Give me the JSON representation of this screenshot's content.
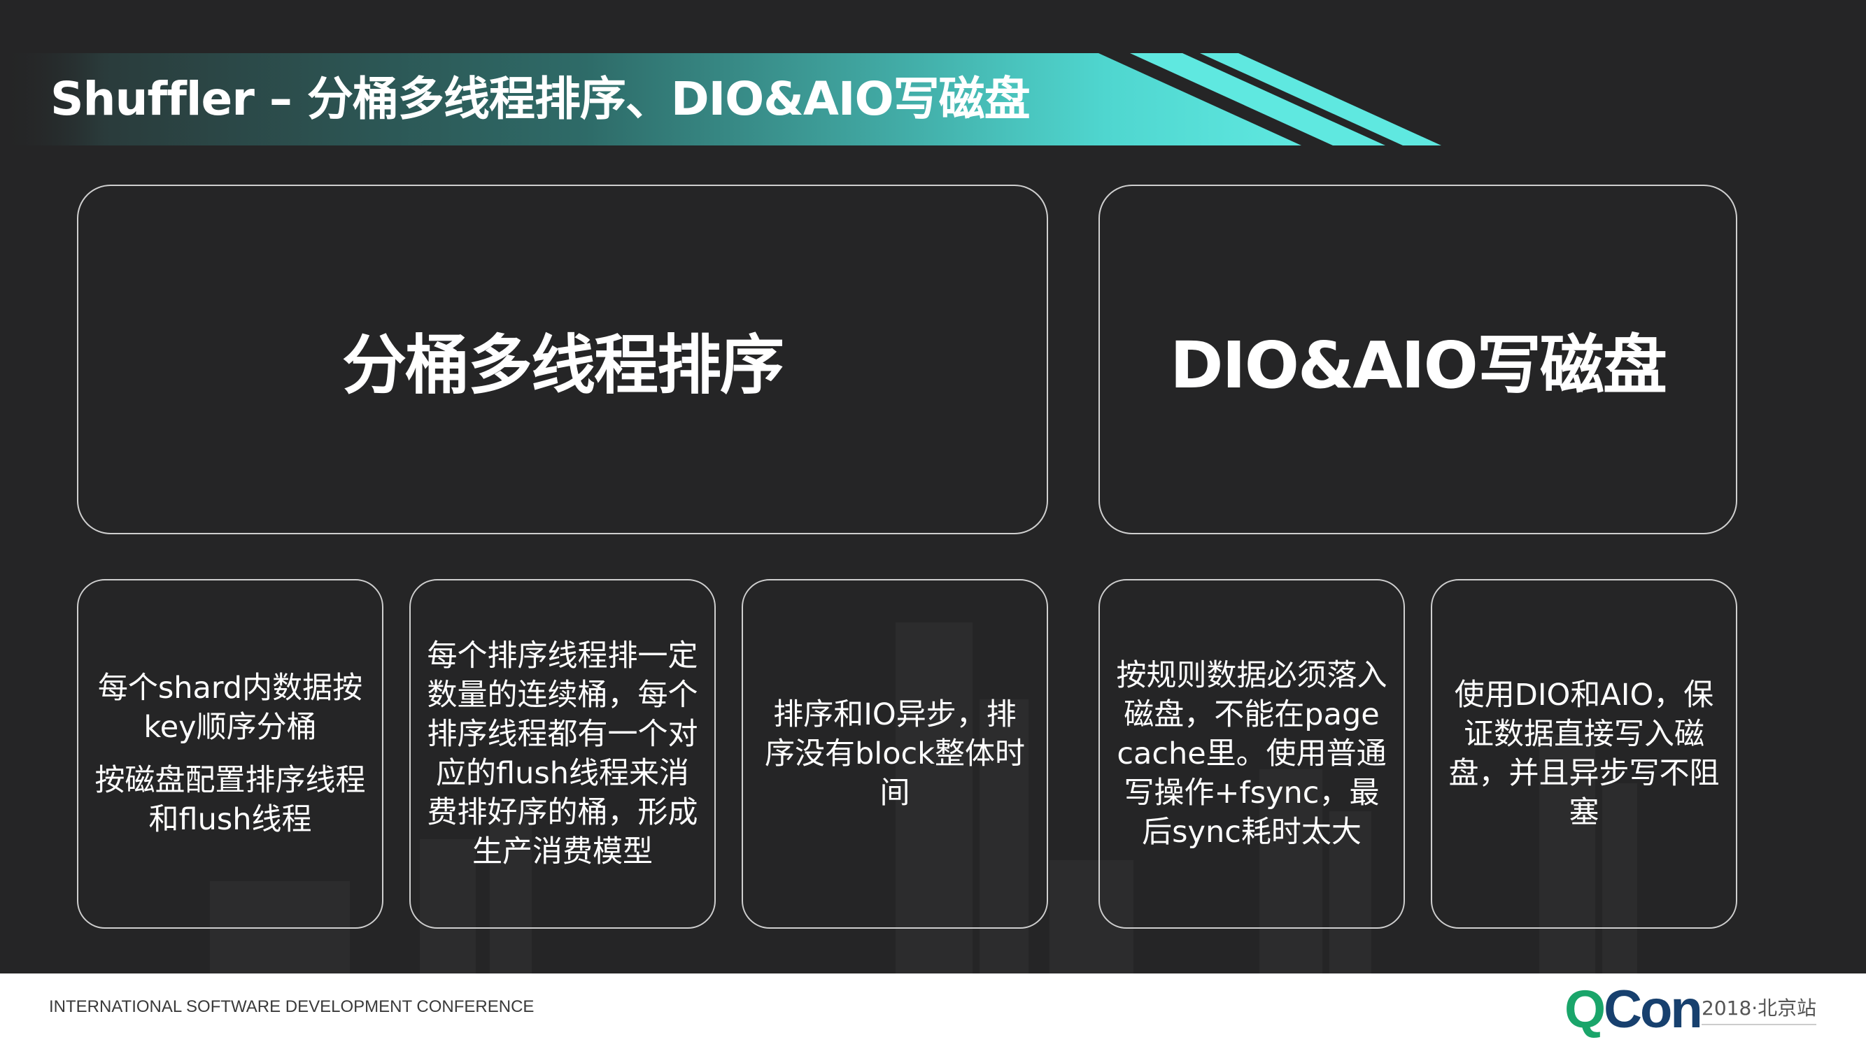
{
  "slide": {
    "title": "Shuffler – 分桶多线程排序、DIO&AIO写磁盘",
    "accent_colors": {
      "banner_start": "#2f4f4f",
      "banner_end": "#5fe8e0",
      "stripe": "#5fe8e0",
      "background": "#252526",
      "box_border": "#cfcfcf"
    }
  },
  "left_panel": {
    "heading": "分桶多线程排序"
  },
  "right_panel": {
    "heading": "DIO&AIO写磁盘"
  },
  "cards": [
    {
      "lines": [
        "每个shard内数据按key顺序分桶",
        "按磁盘配置排序线程和flush线程"
      ]
    },
    {
      "text": "每个排序线程排一定数量的连续桶，每个排序线程都有一个对应的flush线程来消费排好序的桶，形成生产消费模型"
    },
    {
      "text": "排序和IO异步，排序没有block整体时间"
    },
    {
      "text": "按规则数据必须落入磁盘，不能在page cache里。使用普通写操作+fsync，最后sync耗时太大"
    },
    {
      "text": "使用DIO和AIO，保证数据直接写入磁盘，并且异步写不阻塞"
    }
  ],
  "footer": {
    "conference": "INTERNATIONAL SOFTWARE DEVELOPMENT CONFERENCE",
    "logo_q": "Q",
    "logo_con": "Con",
    "edition": "2018·北京站"
  }
}
